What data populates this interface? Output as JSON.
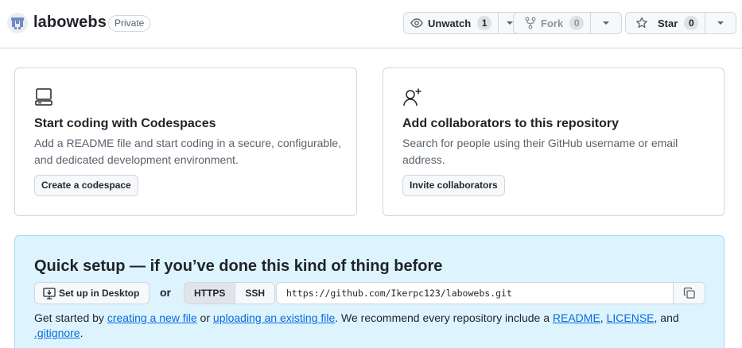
{
  "repo": {
    "name": "labowebs",
    "visibility": "Private"
  },
  "actions": {
    "watch": {
      "label": "Unwatch",
      "count": "1"
    },
    "fork": {
      "label": "Fork",
      "count": "0"
    },
    "star": {
      "label": "Star",
      "count": "0"
    }
  },
  "cards": {
    "codespaces": {
      "icon": "codespaces-icon",
      "title": "Start coding with Codespaces",
      "description": "Add a README file and start coding in a secure, configurable, and dedicated development environment.",
      "button": "Create a codespace"
    },
    "collaborators": {
      "icon": "person-add-icon",
      "title": "Add collaborators to this repository",
      "description": "Search for people using their GitHub username or email address.",
      "button": "Invite collaborators"
    }
  },
  "quick_setup": {
    "title": "Quick setup — if you’ve done this kind of thing before",
    "desktop_button": "Set up in Desktop",
    "or": "or",
    "protocols": [
      "HTTPS",
      "SSH"
    ],
    "selected_protocol": "HTTPS",
    "clone_url": "https://github.com/Ikerpc123/labowebs.git",
    "text": {
      "t1": "Get started by ",
      "link1": "creating a new file",
      "t2": " or ",
      "link2": "uploading an existing file",
      "t3": ". We recommend every repository include a ",
      "link3": "README",
      "t4": ", ",
      "link4": "LICENSE",
      "t5": ", and ",
      "link5": ".gitignore",
      "t6": "."
    }
  },
  "colors": {
    "accent": "#0969da",
    "quick_setup_bg": "#ddf4ff",
    "border": "#d0d7de"
  }
}
